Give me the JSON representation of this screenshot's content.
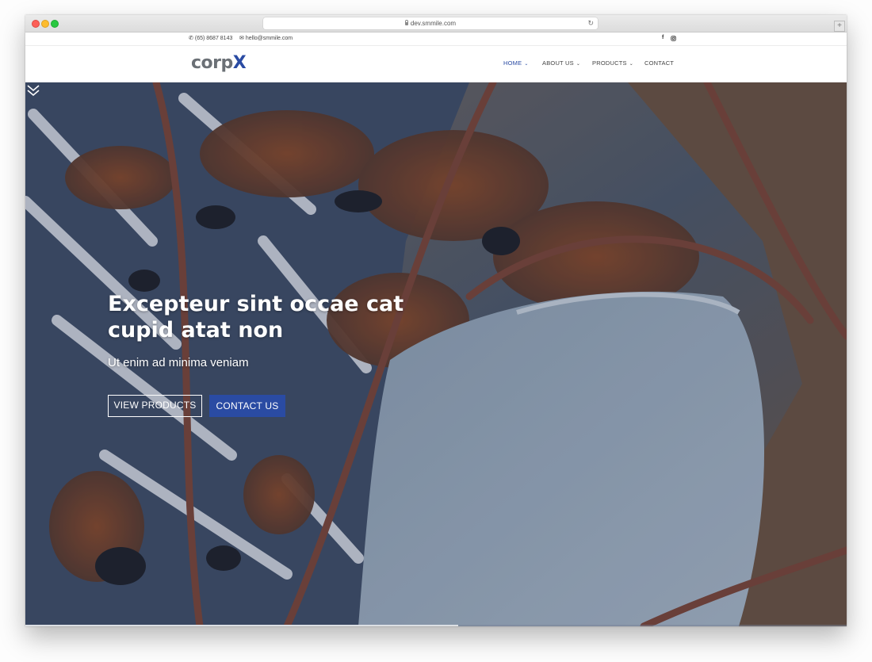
{
  "browser": {
    "url": "dev.smmile.com"
  },
  "topbar": {
    "phone": "(65) 8687 8143",
    "email": "hello@smmile.com",
    "social_icons": [
      "facebook-icon",
      "instagram-icon"
    ]
  },
  "header": {
    "logo_prefix": "corp",
    "logo_accent": "X",
    "nav": [
      {
        "label": "HOME",
        "has_dropdown": true,
        "active": true
      },
      {
        "label": "ABOUT US",
        "has_dropdown": true,
        "active": false
      },
      {
        "label": "PRODUCTS",
        "has_dropdown": true,
        "active": false
      },
      {
        "label": "CONTACT",
        "has_dropdown": false,
        "active": false
      }
    ]
  },
  "hero": {
    "headline": "Excepteur sint occae cat cupid atat non",
    "subheadline": "Ut enim ad minima veniam",
    "primary_button": "VIEW PRODUCTS",
    "secondary_button": "CONTACT US",
    "scroll_icon": "double-chevron-down-icon"
  },
  "colors": {
    "accent": "#2a4ba3",
    "logo_gray": "#6b7076"
  }
}
